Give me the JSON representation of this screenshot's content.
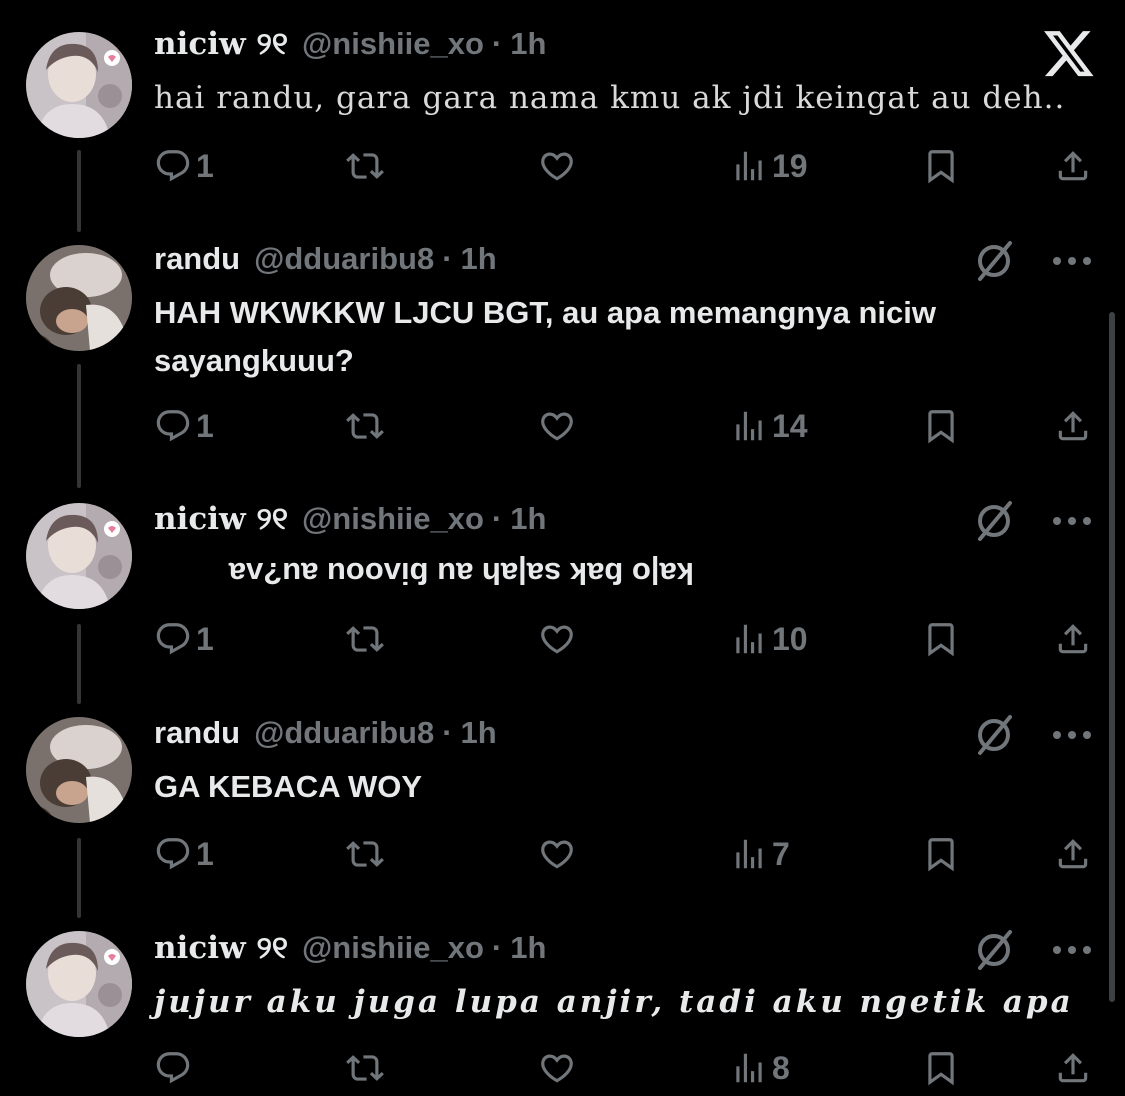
{
  "brand": {
    "logo_icon": "x-logo-icon"
  },
  "tweets": [
    {
      "name": "niciw ୨୧",
      "handle": "@nishiie_xo",
      "separator": "·",
      "time": "1h",
      "text": "hai randu, gara gara nama kmu ak jdi keingat au deh..",
      "text_style": "serif",
      "replies": "1",
      "views": "19"
    },
    {
      "name": "randu",
      "handle": "@dduaribu8",
      "separator": "·",
      "time": "1h",
      "text": "HAH WKWKKW LJCU BGT, au apa memangnya niciw sayangkuuu?",
      "text_style": "bold",
      "replies": "1",
      "views": "14"
    },
    {
      "name": "niciw ୨୧",
      "handle": "@nishiie_xo",
      "separator": "·",
      "time": "1h",
      "text": "ka|o ɓak sa|ah au ɓiʌoou au?ʌa",
      "text_style": "flipped",
      "replies": "1",
      "views": "10"
    },
    {
      "name": "randu",
      "handle": "@dduaribu8",
      "separator": "·",
      "time": "1h",
      "text": "GA KEBACA WOY",
      "text_style": "bold",
      "replies": "1",
      "views": "7"
    },
    {
      "name": "niciw ୨୧",
      "handle": "@nishiie_xo",
      "separator": "·",
      "time": "1h",
      "text": "jujur aku juga lupa anjir, tadi aku ngetik apa",
      "text_style": "gothic",
      "replies": "",
      "views": "8"
    }
  ],
  "icons": {
    "reply": "reply-icon",
    "retweet": "retweet-icon",
    "like": "heart-icon",
    "views": "views-icon",
    "bookmark": "bookmark-icon",
    "share": "share-icon",
    "grok": "grok-icon",
    "more": "more-icon"
  },
  "colors": {
    "background": "#000000",
    "text": "#e7e9ea",
    "muted": "#71767b",
    "thread_line": "#333639"
  }
}
